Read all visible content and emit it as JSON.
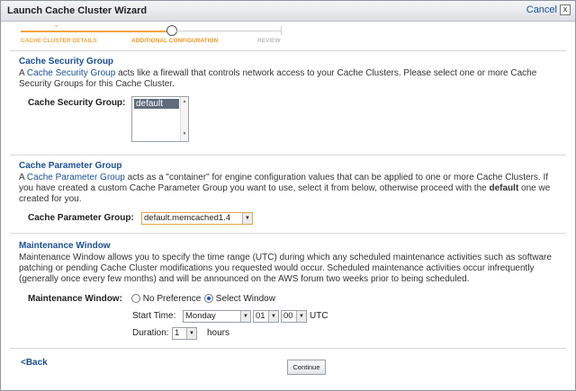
{
  "dialog": {
    "title": "Launch Cache Cluster Wizard",
    "cancel_label": "Cancel",
    "close_glyph": "x"
  },
  "steps": [
    {
      "label": "Cache Cluster Details",
      "state": "completed"
    },
    {
      "label": "Additional Configuration",
      "state": "current"
    },
    {
      "label": "Review",
      "state": "upcoming"
    }
  ],
  "security_group": {
    "heading": "Cache Security Group",
    "desc_prefix": "A ",
    "desc_link": "Cache Security Group",
    "desc_rest": " acts like a firewall that controls network access to your Cache Clusters. Please select one or more Cache Security Groups for this Cache Cluster.",
    "field_label": "Cache Security Group:",
    "options": [
      "default"
    ],
    "selected": "default"
  },
  "parameter_group": {
    "heading": "Cache Parameter Group",
    "desc_prefix": "A ",
    "desc_link": "Cache Parameter Group",
    "desc_mid": " acts as a \"container\" for engine configuration values that can be applied to one or more Cache Clusters. If you have created a custom Cache Parameter Group you want to use, select it from below, otherwise proceed with the ",
    "desc_bold": "default",
    "desc_end": " one we created for you.",
    "field_label": "Cache Parameter Group:",
    "selected": "default.memcached1.4"
  },
  "maintenance": {
    "heading": "Maintenance Window",
    "desc": "Maintenance Window allows you to specify the time range (UTC) during which any scheduled maintenance activities such as software patching or pending Cache Cluster modifications you requested would occur. Scheduled maintenance activities occur infrequently (generally once every few months) and will be announced on the AWS forum two weeks prior to being scheduled.",
    "field_label": "Maintenance Window:",
    "option_no_pref": "No Preference",
    "option_select": "Select Window",
    "selected_option": "Select Window",
    "start_label": "Start Time:",
    "day": "Monday",
    "hour": "01",
    "minute": "00",
    "tz": "UTC",
    "duration_label": "Duration:",
    "duration": "1",
    "duration_unit": "hours"
  },
  "footer": {
    "back_label": "<Back",
    "continue_label": "Continue"
  }
}
